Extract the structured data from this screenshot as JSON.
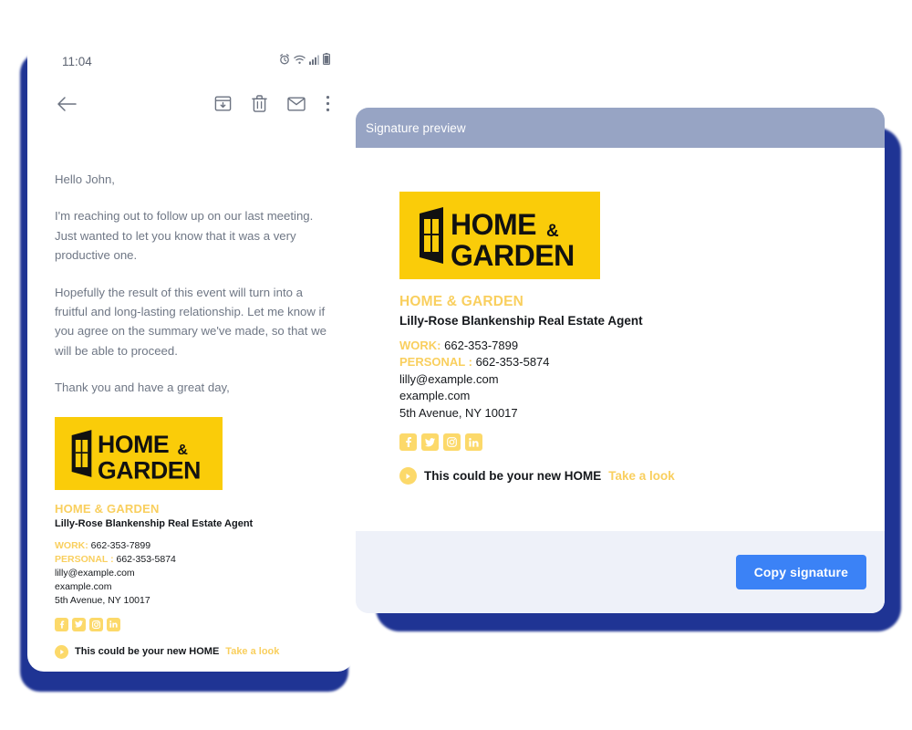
{
  "phone": {
    "status_bar": {
      "clock": "11:04",
      "icons": [
        "alarm-icon",
        "wifi-icon",
        "signal-icon",
        "battery-icon"
      ]
    },
    "toolbar": {
      "back_icon": "back-arrow-icon",
      "archive_icon": "archive-icon",
      "delete_icon": "trash-icon",
      "mark_unread_icon": "envelope-icon",
      "more_icon": "more-vertical-icon"
    },
    "email": {
      "paragraphs": [
        "Hello John,",
        "I'm reaching out to follow up on our last meeting. Just wanted to let you know that it was a very productive one.",
        "Hopefully the result of this event will turn into a fruitful and long-lasting relationship. Let me know if you agree on the summary we've made, so that we will be able to proceed.",
        "Thank you and have a great day,"
      ]
    }
  },
  "desktop": {
    "header_title": "Signature preview",
    "copy_button_label": "Copy signature"
  },
  "signature": {
    "logo_alt": "HOME & GARDEN",
    "company": "HOME & GARDEN",
    "person": "Lilly-Rose Blankenship Real Estate Agent",
    "work_label": "WORK:",
    "work_phone": "662-353-7899",
    "personal_label": "PERSONAL :",
    "personal_phone": "662-353-5874",
    "email": "lilly@example.com",
    "website": "example.com",
    "address": "5th Avenue, NY 10017",
    "social": [
      {
        "name": "facebook-icon",
        "glyph": "f"
      },
      {
        "name": "twitter-icon",
        "glyph": "t"
      },
      {
        "name": "instagram-icon",
        "glyph": "o"
      },
      {
        "name": "linkedin-icon",
        "glyph": "in"
      }
    ],
    "cta_text": "This could be your new HOME",
    "cta_link": "Take a look"
  },
  "colors": {
    "brand_yellow": "#facc09",
    "accent_yellow": "#f9cf5e",
    "social_yellow": "#fcd96a",
    "button_blue": "#3b82f6",
    "header_slate": "#97a4c4",
    "shadow_navy": "#1f3494",
    "panel_lavender": "#eef1f9"
  }
}
